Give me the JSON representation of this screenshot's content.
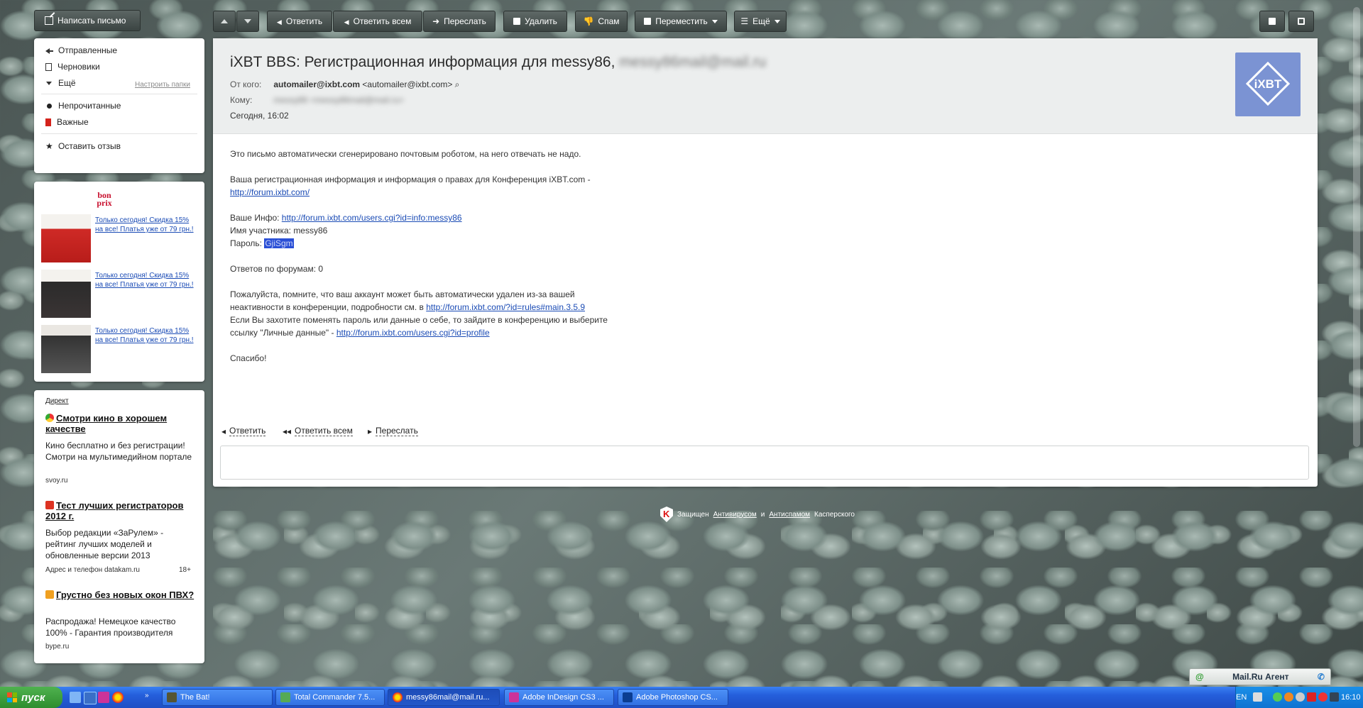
{
  "compose": {
    "label": "Написать письмо"
  },
  "folders": {
    "items": [
      {
        "label": "Отправленные"
      },
      {
        "label": "Черновики"
      },
      {
        "label": "Ещё"
      },
      {
        "label": "Непрочитанные"
      },
      {
        "label": "Важные"
      },
      {
        "label": "Оставить отзыв"
      }
    ],
    "setup_link": "Настроить папки"
  },
  "ads": {
    "brand": "bon prix",
    "items": [
      {
        "text": "Только сегодня! Скидка 15% на все! Платья уже от 79 грн.!"
      },
      {
        "text": "Только сегодня! Скидка 15% на все! Платья уже от 79 грн.!"
      },
      {
        "text": "Только сегодня! Скидка 15% на все! Платья уже от 79 грн.!"
      }
    ]
  },
  "direct": {
    "label": "Директ",
    "items": [
      {
        "title": "Смотри кино в хорошем качестве",
        "desc": "Кино бесплатно и без регистрации! Смотри на мультимедийном портале",
        "source": "svoy.ru"
      },
      {
        "title": "Тест лучших регистраторов 2012 г.",
        "desc": "Выбор редакции «ЗаРулем» - рейтинг лучших моделей и обновленные версии 2013",
        "source": "Адрес и телефон  datakam.ru",
        "age": "18+"
      },
      {
        "title": "Грустно без новых окон ПВХ?",
        "desc": "Распродажа! Немецкое качество 100% - Гарантия производителя",
        "source": "bype.ru"
      }
    ]
  },
  "toolbar": {
    "reply": "Ответить",
    "reply_all": "Ответить всем",
    "forward": "Переслать",
    "delete": "Удалить",
    "spam": "Спам",
    "move": "Переместить",
    "more": "Ещё"
  },
  "message": {
    "subject": "iXBT BBS: Регистрационная информация для messy86,",
    "subject_email": "messy86mail@mail.ru",
    "from_key": "От кого:",
    "from_name": "automailer@ixbt.com",
    "from_addr": "<automailer@ixbt.com>",
    "to_key": "Кому:",
    "to_value": "messy86 <messy86mail@mail.ru>",
    "date": "Сегодня, 16:02",
    "logo_text": "iXBT",
    "body": {
      "l1": "Это письмо автоматически сгенерировано почтовым роботом, на него отвечать не надо.",
      "l2": "Ваша регистрационная информация и информация о правах для Конференция iXBT.com -",
      "l2_link": "http://forum.ixbt.com/",
      "info_label": "Ваше Инфо:",
      "info_link": "http://forum.ixbt.com/users.cgi?id=info:messy86",
      "member": "Имя участника: messy86",
      "pass_label": "Пароль:",
      "pass_value": "GjiSgm",
      "posts": "Ответов по форумам: 0",
      "p1": "Пожалуйста, помните, что ваш аккаунт может быть автоматически удален из-за вашей",
      "p2": "неактивности в конференции, подробности см. в",
      "p2_link": "http://forum.ixbt.com/?id=rules#main.3.5.9",
      "p3": "Если Вы захотите поменять пароль или данные о себе, то зайдите в конференцию и выберите",
      "p4": "ссылку \"Личные данные\" -",
      "p4_link": "http://forum.ixbt.com/users.cgi?id=profile",
      "thanks": "Спасибо!"
    },
    "footer": {
      "reply": "Ответить",
      "reply_all": "Ответить всем",
      "forward": "Переслать"
    }
  },
  "kaspersky": {
    "prefix": "Защищен",
    "antivirus": "Антивирусом",
    "and": "и",
    "antispam": "Антиспамом",
    "suffix": "Касперского"
  },
  "agent": {
    "label": "Mail.Ru Агент"
  },
  "taskbar": {
    "start": "пуск",
    "tasks": [
      {
        "label": "The Bat!"
      },
      {
        "label": "Total Commander 7.5..."
      },
      {
        "label": "messy86mail@mail.ru..."
      },
      {
        "label": "Adobe InDesign CS3 ..."
      },
      {
        "label": "Adobe Photoshop CS..."
      }
    ],
    "lang": "EN",
    "clock": "16:10"
  },
  "colors": {
    "accent_blue": "#1a4bb5",
    "selection": "#2a4fd6",
    "logo_bg": "#7b93d3",
    "taskbar": "#245edb",
    "start": "#2e8d2e"
  }
}
